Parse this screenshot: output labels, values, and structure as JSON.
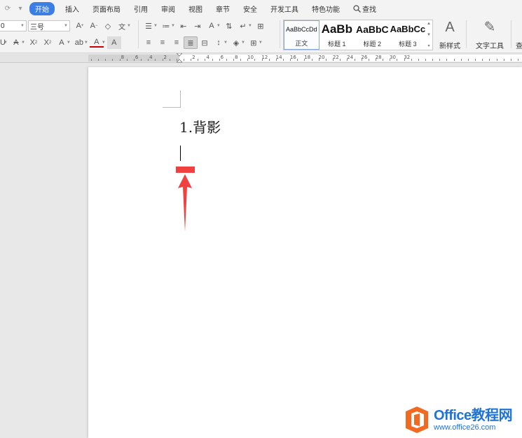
{
  "menubar": {
    "tabs": [
      "插入",
      "页面布局",
      "引用",
      "审阅",
      "视图",
      "章节",
      "安全",
      "开发工具",
      "特色功能"
    ],
    "active_tab": "开始",
    "search_label": "查找"
  },
  "ribbon": {
    "font_name_value": "0",
    "font_size_value": "三号",
    "styles": [
      {
        "sample": "AaBbCcDd",
        "name": "正文"
      },
      {
        "sample": "AaBb",
        "name": "标题 1"
      },
      {
        "sample": "AaBbC",
        "name": "标题 2"
      },
      {
        "sample": "AaBbCc",
        "name": "标题 3"
      }
    ],
    "new_style_label": "新样式",
    "text_tools_label": "文字工具",
    "cut_off_label": "查"
  },
  "ruler": {
    "labels": [
      "8",
      "6",
      "4",
      "2",
      "2",
      "4",
      "6",
      "8",
      "10",
      "12",
      "14",
      "16",
      "18",
      "20",
      "22",
      "24",
      "26",
      "28",
      "30",
      "32"
    ]
  },
  "document": {
    "heading": "1.背影"
  },
  "annotation": {
    "color": "#f04040"
  },
  "watermark": {
    "brand": "Office教程网",
    "url": "www.office26.com"
  },
  "colors": {
    "accent": "#3a7ee6",
    "watermark_blue": "#1e73d6",
    "watermark_orange": "#f26a21"
  }
}
